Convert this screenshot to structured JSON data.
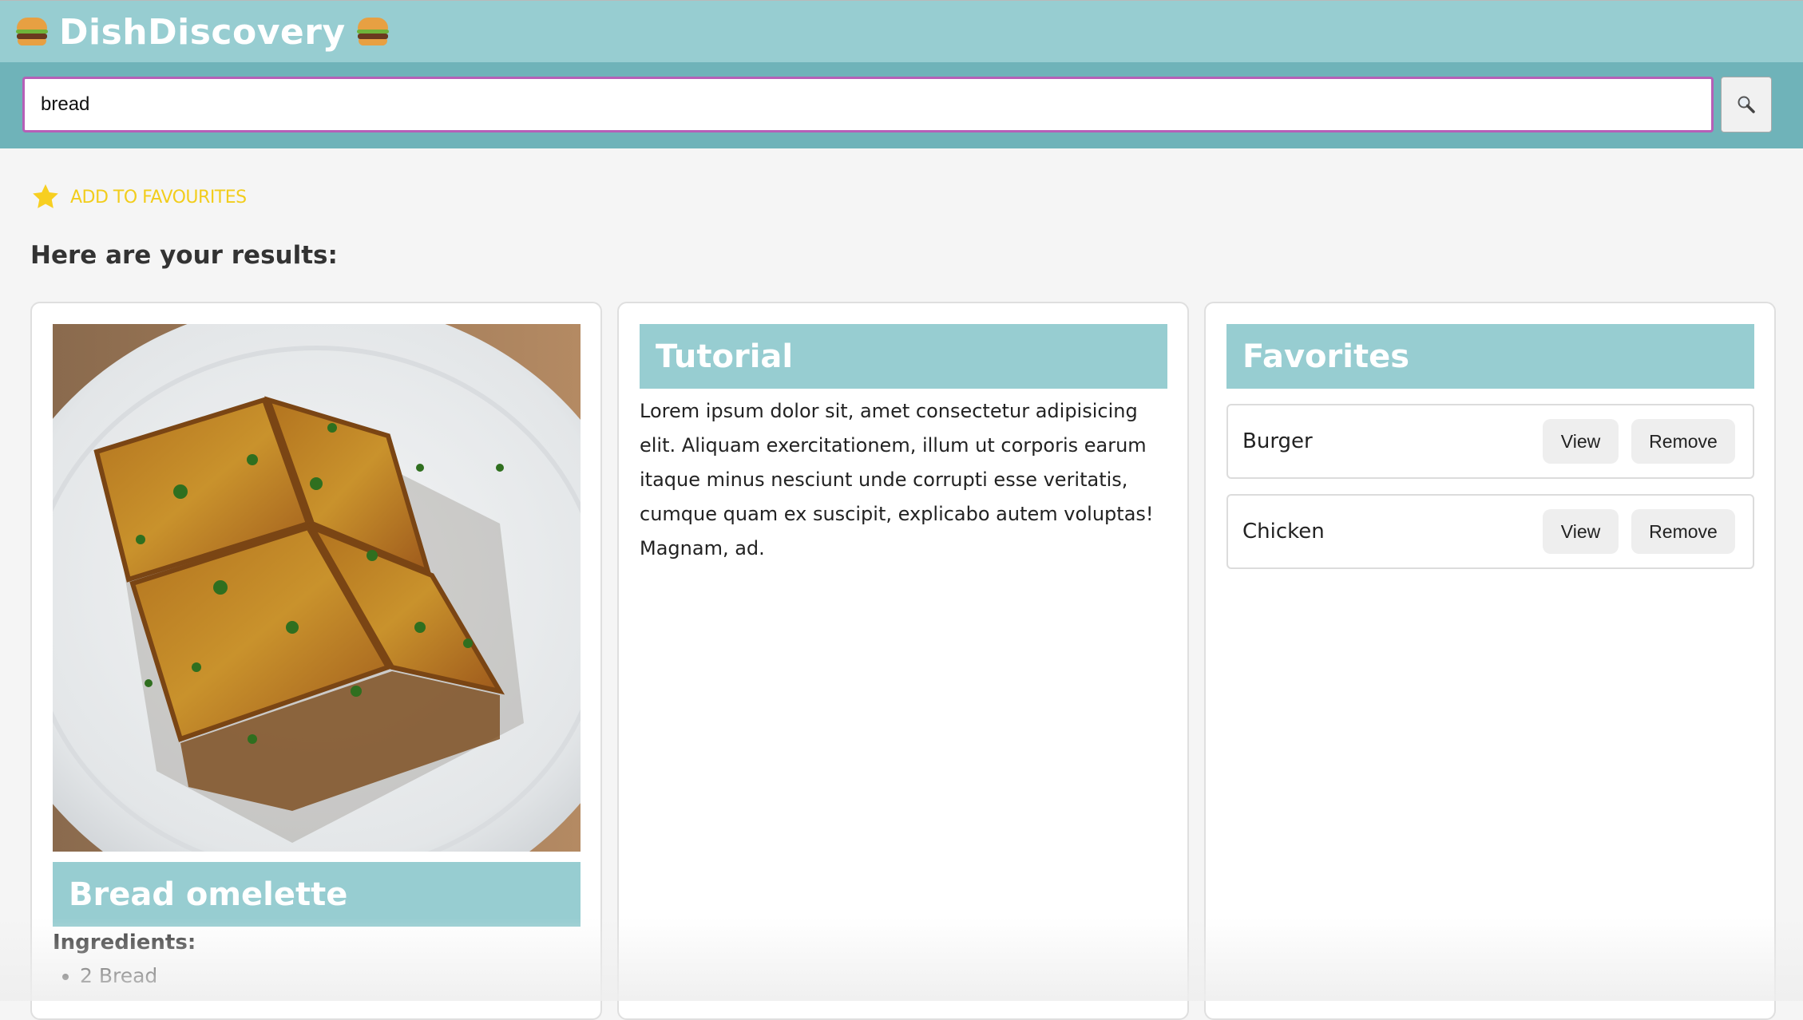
{
  "header": {
    "title": "DishDiscovery",
    "icons": [
      "burger-icon",
      "burger-icon"
    ]
  },
  "search": {
    "value": "bread",
    "button_icon": "magnifier-icon"
  },
  "favourites_link": {
    "icon": "star-icon",
    "label": "ADD TO FAVOURITES"
  },
  "results_heading": "Here are your results:",
  "dish_card": {
    "name": "Bread omelette",
    "ingredients_label": "Ingredients:",
    "ingredients": [
      "2 Bread"
    ]
  },
  "tutorial_card": {
    "title": "Tutorial",
    "text": "Lorem ipsum dolor sit, amet consectetur adipisicing elit. Aliquam exercitationem, illum ut corporis earum itaque minus nesciunt unde corrupti esse veritatis, cumque quam ex suscipit, explicabo autem voluptas! Magnam, ad."
  },
  "favorites_card": {
    "title": "Favorites",
    "items": [
      {
        "name": "Burger",
        "view_label": "View",
        "remove_label": "Remove"
      },
      {
        "name": "Chicken",
        "view_label": "View",
        "remove_label": "Remove"
      }
    ]
  },
  "colors": {
    "header_bg": "#97cdd1",
    "search_bar_bg": "#6fb3b9",
    "band_bg": "#97cdd1",
    "favourite_link": "#f2cd1c",
    "input_focus_border": "#b65fb7"
  }
}
